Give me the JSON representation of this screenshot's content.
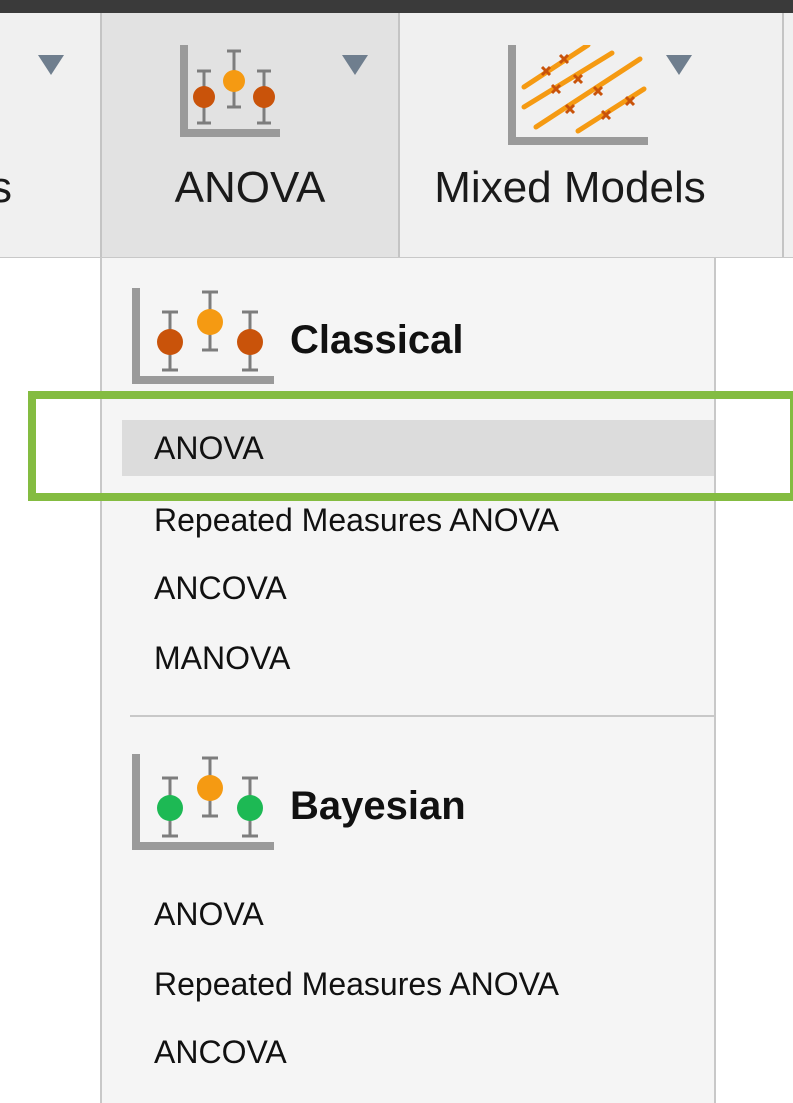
{
  "toolbar": {
    "left_partial_label": "s",
    "anova_label": "ANOVA",
    "mixed_models_label": "Mixed Models"
  },
  "icons": {
    "anova_toolbar": "anova-dotplot-icon",
    "mixed_models_toolbar": "regression-lines-icon",
    "classical": "anova-classical-icon",
    "bayesian": "anova-bayesian-icon",
    "dropdown": "caret-down-icon"
  },
  "colors": {
    "orange": "#f59a12",
    "dark_orange": "#c9530a",
    "green": "#1db954",
    "highlight_border": "#84bc41",
    "caret": "#6f7e8e"
  },
  "menu": {
    "classical": {
      "header": "Classical",
      "items": [
        "ANOVA",
        "Repeated Measures ANOVA",
        "ANCOVA",
        "MANOVA"
      ],
      "selected": "ANOVA"
    },
    "bayesian": {
      "header": "Bayesian",
      "items": [
        "ANOVA",
        "Repeated Measures ANOVA",
        "ANCOVA"
      ]
    }
  }
}
